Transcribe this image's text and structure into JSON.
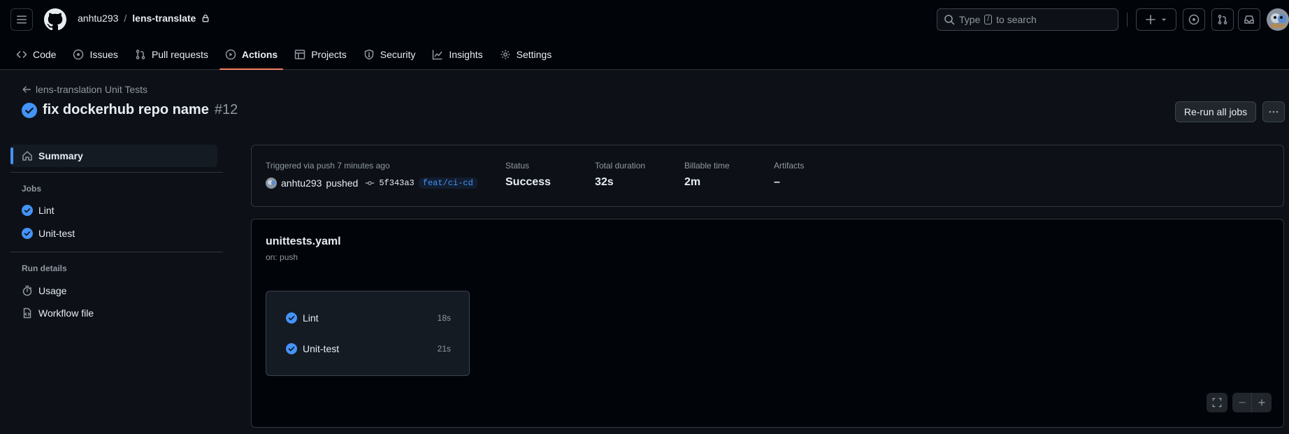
{
  "header": {
    "owner": "anhtu293",
    "separator": "/",
    "repo": "lens-translate",
    "search_prefix": "Type",
    "search_key": "/",
    "search_suffix": "to search"
  },
  "nav": [
    {
      "label": "Code",
      "icon": "code-icon"
    },
    {
      "label": "Issues",
      "icon": "issue-icon"
    },
    {
      "label": "Pull requests",
      "icon": "pull-request-icon"
    },
    {
      "label": "Actions",
      "icon": "play-icon",
      "active": true
    },
    {
      "label": "Projects",
      "icon": "table-icon"
    },
    {
      "label": "Security",
      "icon": "shield-icon"
    },
    {
      "label": "Insights",
      "icon": "graph-icon"
    },
    {
      "label": "Settings",
      "icon": "gear-icon"
    }
  ],
  "page": {
    "back_label": "lens-translation Unit Tests",
    "title": "fix dockerhub repo name",
    "run_number": "#12",
    "rerun_label": "Re-run all jobs"
  },
  "sidebar": {
    "summary_label": "Summary",
    "jobs_heading": "Jobs",
    "jobs": [
      {
        "label": "Lint"
      },
      {
        "label": "Unit-test"
      }
    ],
    "run_details_heading": "Run details",
    "usage_label": "Usage",
    "workflow_file_label": "Workflow file"
  },
  "summary": {
    "trigger": "Triggered via push 7 minutes ago",
    "actor": "anhtu293",
    "action": "pushed",
    "sha": "5f343a3",
    "branch": "feat/ci-cd",
    "status_label": "Status",
    "status": "Success",
    "duration_label": "Total duration",
    "duration": "32s",
    "billable_label": "Billable time",
    "billable": "2m",
    "artifacts_label": "Artifacts",
    "artifacts": "–"
  },
  "workflow": {
    "file": "unittests.yaml",
    "on": "on: push",
    "jobs": [
      {
        "name": "Lint",
        "duration": "18s"
      },
      {
        "name": "Unit-test",
        "duration": "21s"
      }
    ]
  },
  "colors": {
    "success": "#4493f8",
    "active_tab": "#f78166",
    "background": "#0d1117"
  }
}
